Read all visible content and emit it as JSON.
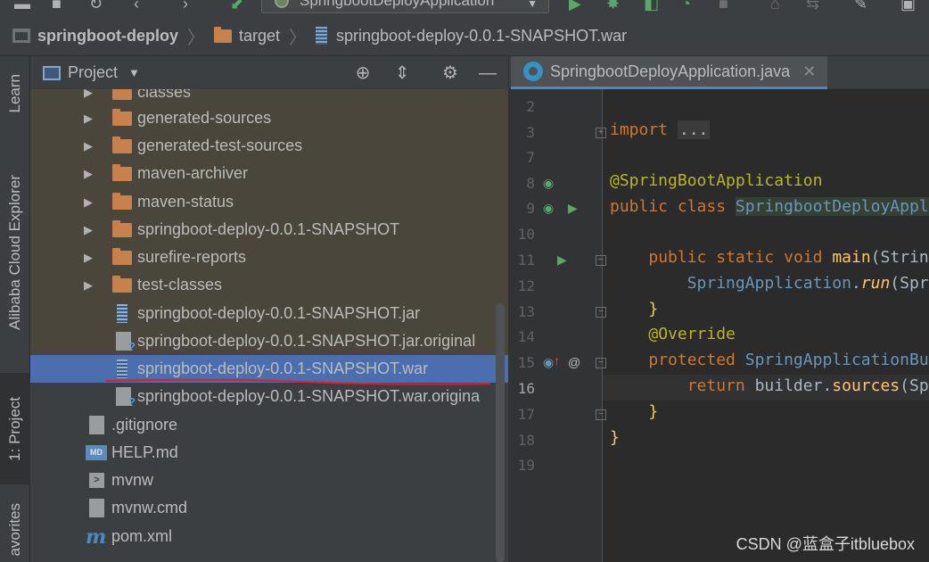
{
  "toolbar": {
    "run_config": "SpringbootDeployApplication"
  },
  "breadcrumb": {
    "project": "springboot-deploy",
    "folder": "target",
    "file": "springboot-deploy-0.0.1-SNAPSHOT.war"
  },
  "left_strip": {
    "learn": "Learn",
    "cloud": "Alibaba Cloud Explorer",
    "project": "1: Project",
    "favorites": "avorites"
  },
  "project_panel": {
    "title": "Project",
    "tree": [
      {
        "label": "classes",
        "type": "folder"
      },
      {
        "label": "generated-sources",
        "type": "folder"
      },
      {
        "label": "generated-test-sources",
        "type": "folder"
      },
      {
        "label": "maven-archiver",
        "type": "folder"
      },
      {
        "label": "maven-status",
        "type": "folder"
      },
      {
        "label": "springboot-deploy-0.0.1-SNAPSHOT",
        "type": "folder"
      },
      {
        "label": "surefire-reports",
        "type": "folder"
      },
      {
        "label": "test-classes",
        "type": "folder"
      },
      {
        "label": "springboot-deploy-0.0.1-SNAPSHOT.jar",
        "type": "jar"
      },
      {
        "label": "springboot-deploy-0.0.1-SNAPSHOT.jar.original",
        "type": "unknown"
      },
      {
        "label": "springboot-deploy-0.0.1-SNAPSHOT.war",
        "type": "jar",
        "selected": true
      },
      {
        "label": "springboot-deploy-0.0.1-SNAPSHOT.war.origina",
        "type": "unknown"
      },
      {
        "label": ".gitignore",
        "type": "file"
      },
      {
        "label": "HELP.md",
        "type": "markdown"
      },
      {
        "label": "mvnw",
        "type": "shell"
      },
      {
        "label": "mvnw.cmd",
        "type": "file"
      },
      {
        "label": "pom.xml",
        "type": "maven"
      }
    ]
  },
  "editor": {
    "tab_title": "SpringbootDeployApplication.java",
    "line_numbers": [
      "2",
      "3",
      "7",
      "8",
      "9",
      "10",
      "11",
      "12",
      "13",
      "14",
      "15",
      "16",
      "17",
      "18",
      "19"
    ],
    "current_line": "16",
    "code": {
      "import_kw": "import",
      "import_dots": "...",
      "annotation": "@SpringBootApplication",
      "public": "public",
      "class": "class",
      "class_name": "SpringbootDeployAppl",
      "static": "static",
      "void": "void",
      "main": "main",
      "string_param": "(Strin",
      "spring_app": "SpringApplication",
      "run": "run",
      "run_arg": "(Spr",
      "close_brace": "}",
      "override": "@Override",
      "protected": "protected",
      "builder_type": "SpringApplicationBu",
      "return": "return",
      "builder": "builder",
      "sources": "sources",
      "sources_arg": "(Sp"
    }
  },
  "watermark": "CSDN @蓝盒子itbluebox"
}
